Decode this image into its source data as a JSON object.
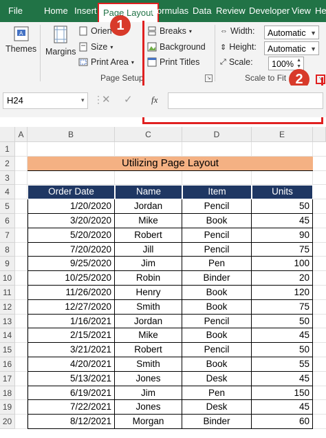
{
  "ribbon_tabs": [
    "File",
    "Home",
    "Insert",
    "Page Layout",
    "Formulas",
    "Data",
    "Review",
    "Developer",
    "View",
    "He"
  ],
  "active_tab": "Page Layout",
  "themes_group": {
    "themes_label": "Themes"
  },
  "page_setup": {
    "margins_label": "Margins",
    "orientation_label": "Orien",
    "size_label": "Size",
    "print_area_label": "Print Area",
    "breaks_label": "Breaks",
    "background_label": "Background",
    "print_titles_label": "Print Titles",
    "group_label": "Page Setup"
  },
  "scale_to_fit": {
    "width_label": "Width:",
    "width_value": "Automatic",
    "height_label": "Height:",
    "height_value": "Automatic",
    "scale_label": "Scale:",
    "scale_value": "100%",
    "group_label": "Scale to Fit"
  },
  "callouts": {
    "one": "1",
    "two": "2"
  },
  "formula_bar": {
    "name_box": "H24",
    "fx": "fx"
  },
  "columns": [
    "A",
    "B",
    "C",
    "D",
    "E"
  ],
  "rows": [
    "1",
    "2",
    "3",
    "4",
    "5",
    "6",
    "7",
    "8",
    "9",
    "10",
    "11",
    "12",
    "13",
    "14",
    "15",
    "16",
    "17",
    "18",
    "19",
    "20"
  ],
  "sheet_title": "Utilizing Page Layout",
  "table": {
    "headers": [
      "Order Date",
      "Name",
      "Item",
      "Units"
    ],
    "rows": [
      [
        "1/20/2020",
        "Jordan",
        "Pencil",
        "50"
      ],
      [
        "3/20/2020",
        "Mike",
        "Book",
        "45"
      ],
      [
        "5/20/2020",
        "Robert",
        "Pencil",
        "90"
      ],
      [
        "7/20/2020",
        "Jill",
        "Pencil",
        "75"
      ],
      [
        "9/25/2020",
        "Jim",
        "Pen",
        "100"
      ],
      [
        "10/25/2020",
        "Robin",
        "Binder",
        "20"
      ],
      [
        "11/26/2020",
        "Henry",
        "Book",
        "120"
      ],
      [
        "12/27/2020",
        "Smith",
        "Book",
        "75"
      ],
      [
        "1/16/2021",
        "Jordan",
        "Pencil",
        "50"
      ],
      [
        "2/15/2021",
        "Mike",
        "Book",
        "45"
      ],
      [
        "3/21/2021",
        "Robert",
        "Pencil",
        "50"
      ],
      [
        "4/20/2021",
        "Smith",
        "Book",
        "55"
      ],
      [
        "5/13/2021",
        "Jones",
        "Desk",
        "45"
      ],
      [
        "6/19/2021",
        "Jim",
        "Pen",
        "150"
      ],
      [
        "7/22/2021",
        "Jones",
        "Desk",
        "45"
      ],
      [
        "8/12/2021",
        "Morgan",
        "Binder",
        "60"
      ]
    ]
  },
  "colors": {
    "ribbon_green": "#217346",
    "header_navy": "#1f3763",
    "title_fill": "#f4b183",
    "callout_red": "#d83a2a"
  }
}
